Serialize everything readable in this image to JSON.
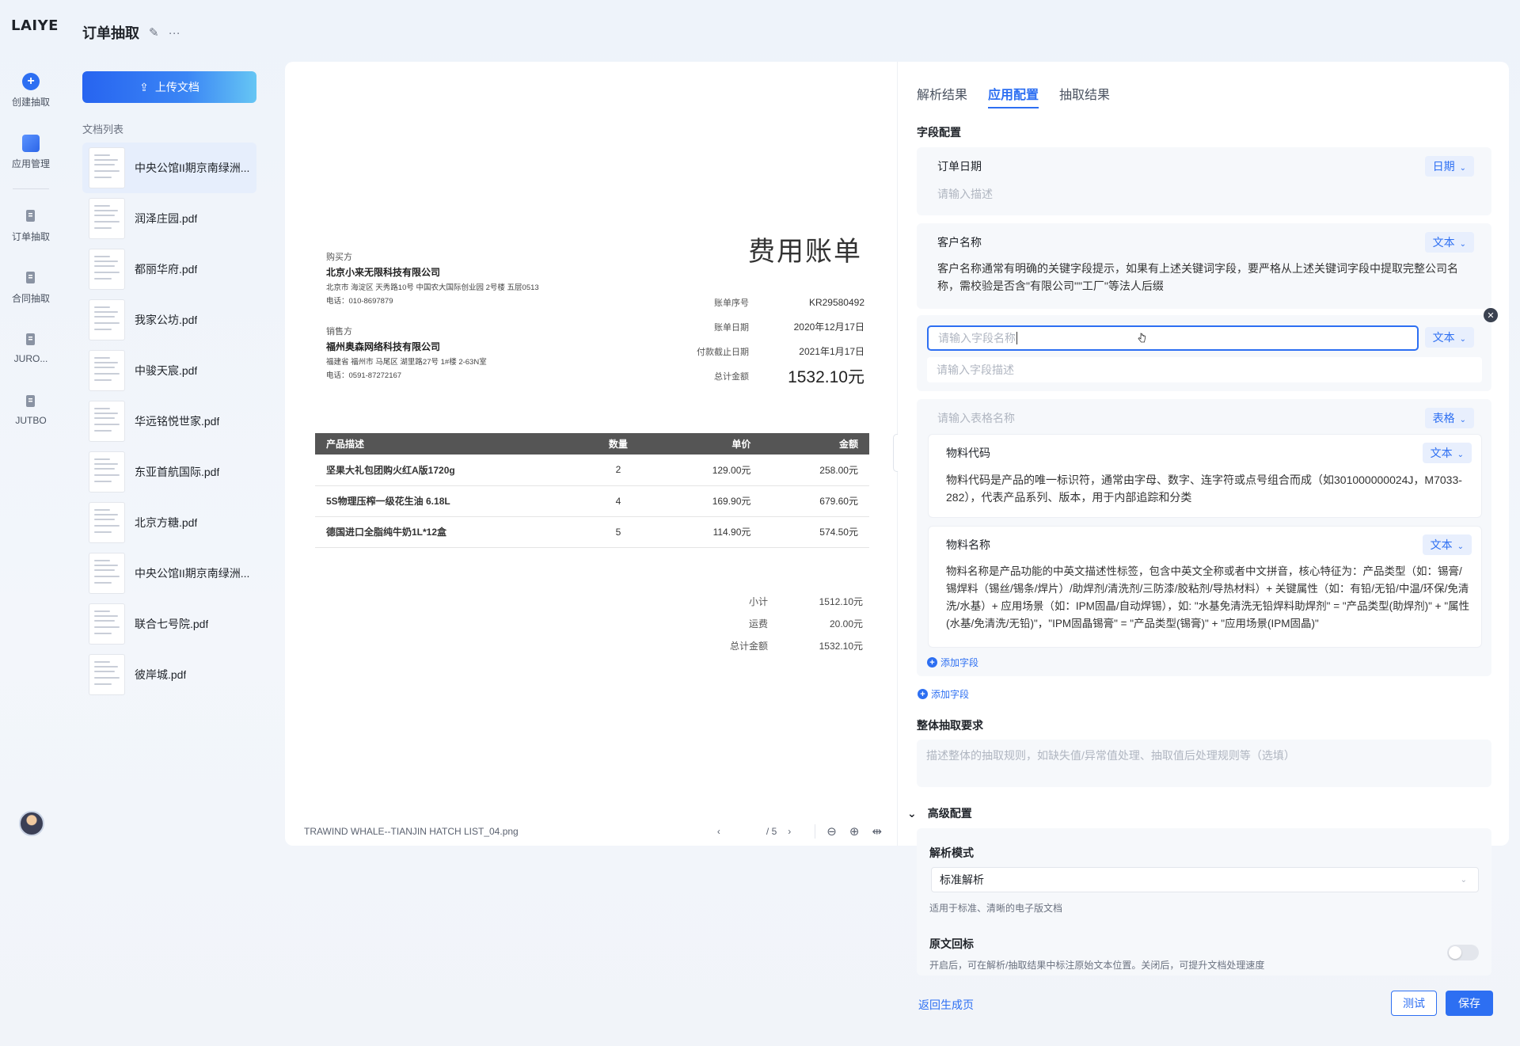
{
  "rail": {
    "logo": "LAIYE",
    "items": [
      {
        "label": "创建抽取",
        "icon": "plus-circle-icon"
      },
      {
        "label": "应用管理",
        "icon": "folder-icon"
      },
      {
        "label": "订单抽取",
        "icon": "doc-icon"
      },
      {
        "label": "合同抽取",
        "icon": "doc-icon"
      },
      {
        "label": "JURO...",
        "icon": "doc-icon"
      },
      {
        "label": "JUTBO",
        "icon": "doc-icon"
      }
    ]
  },
  "header": {
    "title": "订单抽取"
  },
  "docs": {
    "upload_label": "上传文档",
    "list_label": "文档列表",
    "items": [
      "中央公馆II期京南绿洲...",
      "润泽庄园.pdf",
      "都丽华府.pdf",
      "我家公坊.pdf",
      "中骏天宸.pdf",
      "华远铭悦世家.pdf",
      "东亚首航国际.pdf",
      "北京方糖.pdf",
      "中央公馆II期京南绿洲...",
      "联合七号院.pdf",
      "彼岸城.pdf"
    ]
  },
  "invoice": {
    "title": "费用账单",
    "buyer": {
      "label": "购买方",
      "company": "北京小来无限科技有限公司",
      "address": "北京市 海淀区 天秀路10号 中国农大国际创业园 2号楼 五层0513",
      "phone": "电话：010-8697879"
    },
    "seller": {
      "label": "销售方",
      "company": "福州奥森网络科技有限公司",
      "address": "福建省 福州市 马尾区 湖里路27号 1#楼 2-63N室",
      "phone": "电话：0591-87272167"
    },
    "meta": [
      {
        "k": "账单序号",
        "v": "KR29580492"
      },
      {
        "k": "账单日期",
        "v": "2020年12月17日"
      },
      {
        "k": "付款截止日期",
        "v": "2021年1月17日"
      },
      {
        "k": "总计金额",
        "v": "1532.10元"
      }
    ],
    "columns": [
      "产品描述",
      "数量",
      "单价",
      "金额"
    ],
    "rows": [
      [
        "坚果大礼包团购火红A版1720g",
        "2",
        "129.00元",
        "258.00元"
      ],
      [
        "5S物理压榨一级花生油 6.18L",
        "4",
        "169.90元",
        "679.60元"
      ],
      [
        "德国进口全脂纯牛奶1L*12盒",
        "5",
        "114.90元",
        "574.50元"
      ]
    ],
    "summary": [
      {
        "k": "小计",
        "v": "1512.10元"
      },
      {
        "k": "运费",
        "v": "20.00元"
      },
      {
        "k": "总计金额",
        "v": "1532.10元"
      }
    ]
  },
  "viewer": {
    "filename": "TRAWIND WHALE--TIANJIN HATCH LIST_04.png",
    "page_total": "/ 5"
  },
  "panel": {
    "tabs": [
      "解析结果",
      "应用配置",
      "抽取结果"
    ],
    "field_config_title": "字段配置",
    "fields": [
      {
        "name": "订单日期",
        "type": "日期",
        "desc_placeholder": "请输入描述"
      },
      {
        "name": "客户名称",
        "type": "文本",
        "desc": "客户名称通常有明确的关键字段提示，如果有上述关键词字段，要严格从上述关键词字段中提取完整公司名称，需校验是否含\"有限公司\"\"工厂\"等法人后缀"
      }
    ],
    "new_field": {
      "name_placeholder": "请输入字段名称",
      "desc_placeholder": "请输入字段描述",
      "type": "文本"
    },
    "table_field": {
      "name_placeholder": "请输入表格名称",
      "type": "表格",
      "subfields": [
        {
          "name": "物料代码",
          "type": "文本",
          "desc": "物料代码是产品的唯一标识符，通常由字母、数字、连字符或点号组合而成（如301000000024J，M7033-282），代表产品系列、版本，用于内部追踪和分类"
        },
        {
          "name": "物料名称",
          "type": "文本",
          "desc": "物料名称是产品功能的中英文描述性标签，包含中英文全称或者中文拼音，核心特征为：产品类型（如：锡膏/锡焊料（锡丝/锡条/焊片）/助焊剂/清洗剂/三防漆/胶粘剂/导热材料）+ 关键属性（如：有铅/无铅/中温/环保/免清洗/水基）+ 应用场景（如：IPM固晶/自动焊锡），如: \"水基免清洗无铅焊料助焊剂\" = \"产品类型(助焊剂)\" + \"属性(水基/免清洗/无铅)\"，\"IPM固晶锡膏\" = \"产品类型(锡膏)\" + \"应用场景(IPM固晶)\""
        }
      ],
      "add_sub_label": "添加字段"
    },
    "add_field_label": "添加字段",
    "requirement_title": "整体抽取要求",
    "requirement_placeholder": "描述整体的抽取规则，如缺失值/异常值处理、抽取值后处理规则等（选填）",
    "advanced_title": "高级配置",
    "parse_mode_label": "解析模式",
    "parse_mode_value": "标准解析",
    "parse_mode_hint": "适用于标准、清晰的电子版文档",
    "source_mark_label": "原文回标",
    "source_mark_hint": "开启后，可在解析/抽取结果中标注原始文本位置。关闭后，可提升文档处理速度",
    "source_mark_enabled": false,
    "back_label": "返回生成页",
    "test_label": "测试",
    "save_label": "保存"
  },
  "colors": {
    "accent": "#2d6ff2",
    "panel_bg": "#f6f8fb"
  }
}
